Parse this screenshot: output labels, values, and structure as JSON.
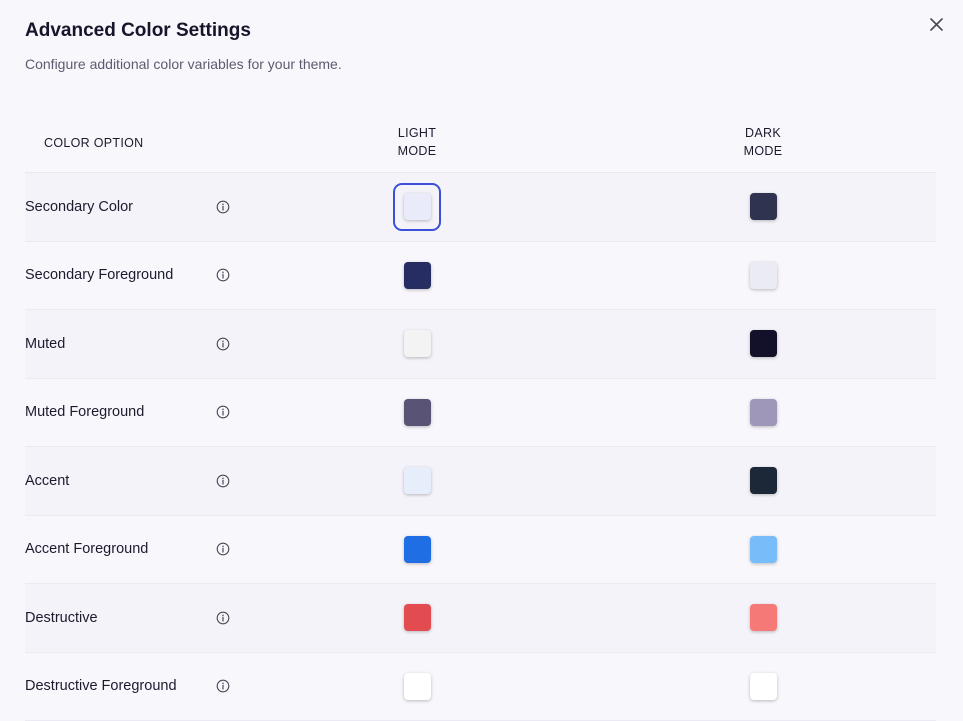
{
  "dialog": {
    "title": "Advanced Color Settings",
    "subtitle": "Configure additional color variables for your theme."
  },
  "table": {
    "headers": {
      "option": "COLOR OPTION",
      "light_line1": "LIGHT",
      "light_line2": "MODE",
      "dark_line1": "DARK",
      "dark_line2": "MODE"
    },
    "rows": [
      {
        "label": "Secondary Color",
        "light": "#e9ebfb",
        "dark": "#2f3350",
        "selected": "light"
      },
      {
        "label": "Secondary Foreground",
        "light": "#262d63",
        "dark": "#ebebf4",
        "selected": ""
      },
      {
        "label": "Muted",
        "light": "#f3f3f4",
        "dark": "#13112a",
        "selected": ""
      },
      {
        "label": "Muted Foreground",
        "light": "#595475",
        "dark": "#9f97ba",
        "selected": ""
      },
      {
        "label": "Accent",
        "light": "#e6edfb",
        "dark": "#1c2838",
        "selected": ""
      },
      {
        "label": "Accent Foreground",
        "light": "#1f6ee3",
        "dark": "#78bdf9",
        "selected": ""
      },
      {
        "label": "Destructive",
        "light": "#e24b4f",
        "dark": "#f57976",
        "selected": ""
      },
      {
        "label": "Destructive Foreground",
        "light": "#ffffff",
        "dark": "#ffffff",
        "selected": ""
      }
    ]
  },
  "icons": {
    "close": "close-icon",
    "info": "info-icon"
  }
}
